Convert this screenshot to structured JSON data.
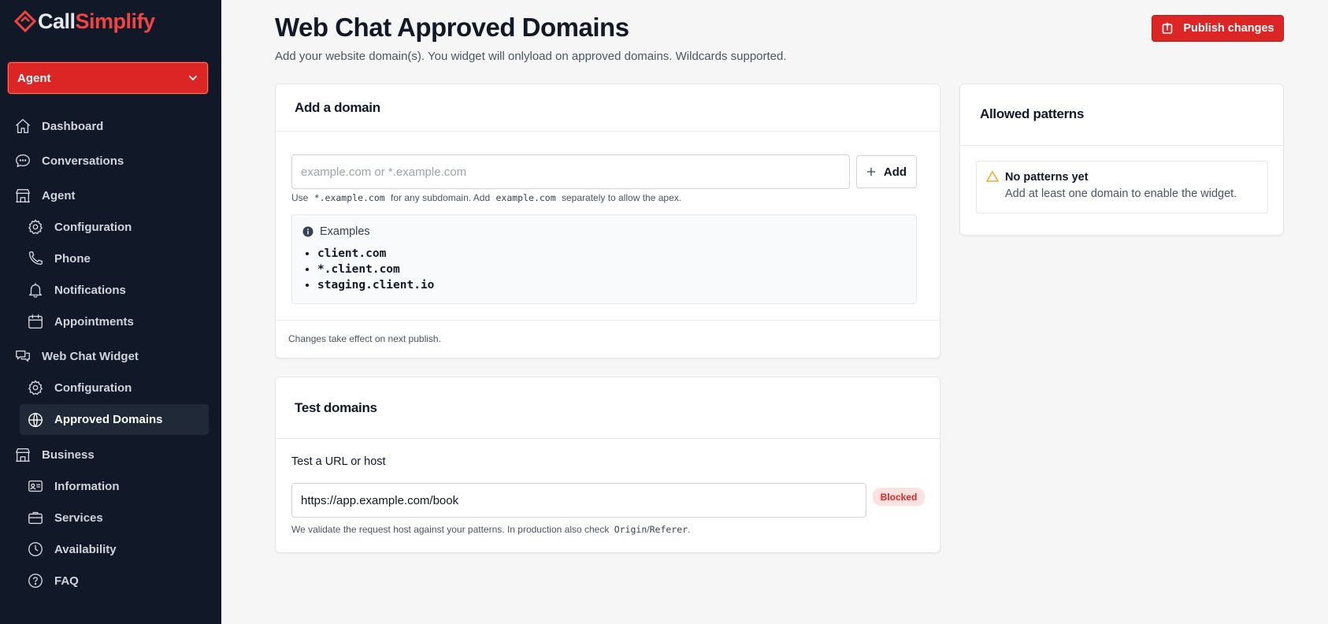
{
  "brand": {
    "part1": "Call",
    "part2": "Simplify",
    "accent": "#ef4444"
  },
  "agent_select": {
    "value": "Agent"
  },
  "sidebar": {
    "dashboard": "Dashboard",
    "conversations": "Conversations",
    "agent": "Agent",
    "agent_configuration": "Configuration",
    "phone": "Phone",
    "notifications": "Notifications",
    "appointments": "Appointments",
    "web_chat_widget": "Web Chat Widget",
    "widget_configuration": "Configuration",
    "approved_domains": "Approved Domains",
    "business": "Business",
    "information": "Information",
    "services": "Services",
    "availability": "Availability",
    "faq": "FAQ"
  },
  "header": {
    "title": "Web Chat Approved Domains",
    "subtitle": "Add your website domain(s). You widget will onlyload on approved domains. Wildcards supported.",
    "publish_label": "Publish changes"
  },
  "add_domain": {
    "title": "Add a domain",
    "placeholder": "example.com or *.example.com",
    "add_label": "Add",
    "hint_use": "Use",
    "hint_code1": "*.example.com",
    "hint_mid": "for any subdomain. Add",
    "hint_code2": "example.com",
    "hint_end": "separately to allow the apex.",
    "examples_title": "Examples",
    "examples": [
      "client.com",
      "*.client.com",
      "staging.client.io"
    ],
    "footer": "Changes take effect on next publish."
  },
  "allowed": {
    "title": "Allowed patterns",
    "empty_title": "No patterns yet",
    "empty_desc": "Add at least one domain to enable the widget."
  },
  "test": {
    "title": "Test domains",
    "label": "Test a URL or host",
    "value": "https://app.example.com/book",
    "status": "Blocked",
    "note_pre": "We validate the request host against your patterns. In production also check",
    "note_code1": "Origin",
    "note_slash": "/",
    "note_code2": "Referer",
    "note_end": "."
  }
}
